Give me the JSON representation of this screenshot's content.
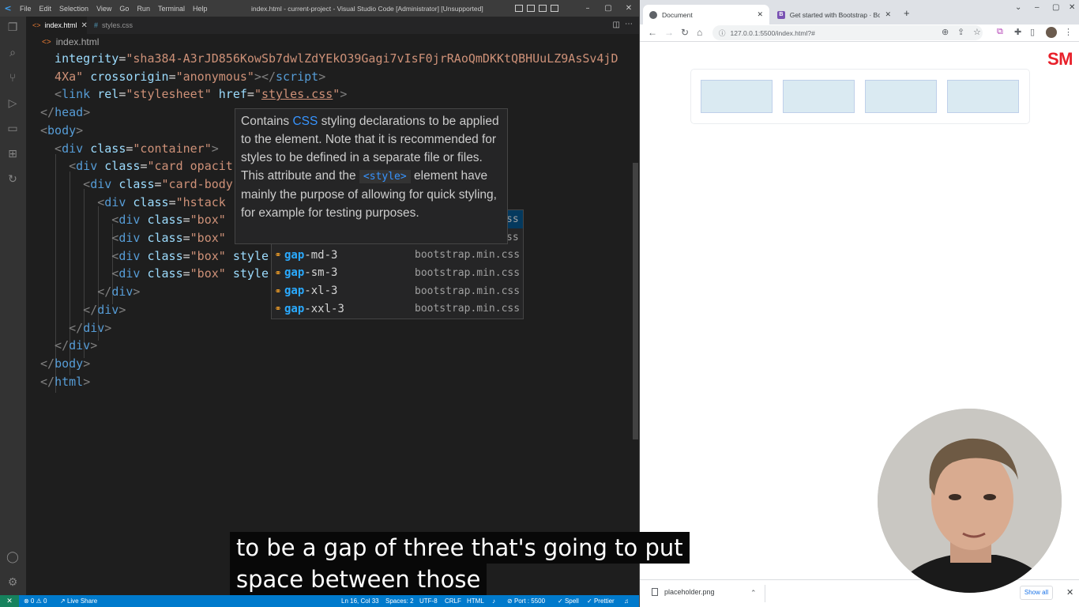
{
  "vscode": {
    "window_title": "index.html - current-project - Visual Studio Code [Administrator] [Unsupported]",
    "menu": [
      "File",
      "Edit",
      "Selection",
      "View",
      "Go",
      "Run",
      "Terminal",
      "Help"
    ],
    "tabs": [
      {
        "label": "index.html",
        "active": true,
        "icon": "html-file-icon"
      },
      {
        "label": "styles.css",
        "active": false,
        "icon": "css-file-icon"
      }
    ],
    "breadcrumb": "index.html",
    "code_lines": [
      [
        [
          "t-attr",
          "  integrity"
        ],
        [
          "t-txt",
          "="
        ],
        [
          "t-str",
          "\"sha384-A3rJD856KowSb7dwlZdYEkO39Gagi7vIsF0jrRAoQmDKKtQBHUuLZ9AsSv4jD"
        ]
      ],
      [
        [
          "t-str",
          "  4Xa\""
        ],
        [
          "t-txt",
          " "
        ],
        [
          "t-attr",
          "crossorigin"
        ],
        [
          "t-txt",
          "="
        ],
        [
          "t-str",
          "\"anonymous\""
        ],
        [
          "t-tag",
          "></"
        ],
        [
          "t-name",
          "script"
        ],
        [
          "t-tag",
          ">"
        ]
      ],
      [
        [
          "t-tag",
          "  <"
        ],
        [
          "t-name",
          "link"
        ],
        [
          "t-txt",
          " "
        ],
        [
          "t-attr",
          "rel"
        ],
        [
          "t-txt",
          "="
        ],
        [
          "t-str",
          "\"stylesheet\""
        ],
        [
          "t-txt",
          " "
        ],
        [
          "t-attr",
          "href"
        ],
        [
          "t-txt",
          "="
        ],
        [
          "t-str",
          "\""
        ],
        [
          "t-str t-link",
          "styles.css"
        ],
        [
          "t-str",
          "\""
        ],
        [
          "t-tag",
          ">"
        ]
      ],
      [
        [
          "t-tag",
          "</"
        ],
        [
          "t-name",
          "head"
        ],
        [
          "t-tag",
          ">"
        ]
      ],
      [
        [
          "t-tag",
          "<"
        ],
        [
          "t-name",
          "body"
        ],
        [
          "t-tag",
          ">"
        ]
      ],
      [
        [
          "t-tag",
          "  <"
        ],
        [
          "t-name",
          "div"
        ],
        [
          "t-txt",
          " "
        ],
        [
          "t-attr",
          "class"
        ],
        [
          "t-txt",
          "="
        ],
        [
          "t-str",
          "\"container\""
        ],
        [
          "t-tag",
          ">"
        ]
      ],
      [
        [
          "t-tag",
          "    <"
        ],
        [
          "t-name",
          "div"
        ],
        [
          "t-txt",
          " "
        ],
        [
          "t-attr",
          "class"
        ],
        [
          "t-txt",
          "="
        ],
        [
          "t-str",
          "\"card opacit"
        ]
      ],
      [
        [
          "t-tag",
          "      <"
        ],
        [
          "t-name",
          "div"
        ],
        [
          "t-txt",
          " "
        ],
        [
          "t-attr",
          "class"
        ],
        [
          "t-txt",
          "="
        ],
        [
          "t-str",
          "\"card-body"
        ]
      ],
      [
        [
          "t-tag",
          "        <"
        ],
        [
          "t-name",
          "div"
        ],
        [
          "t-txt",
          " "
        ],
        [
          "t-attr",
          "class"
        ],
        [
          "t-txt",
          "="
        ],
        [
          "t-str",
          "\"hstack"
        ]
      ],
      [
        [
          "t-tag",
          "          <"
        ],
        [
          "t-name",
          "div"
        ],
        [
          "t-txt",
          " "
        ],
        [
          "t-attr",
          "class"
        ],
        [
          "t-txt",
          "="
        ],
        [
          "t-str",
          "\"box\""
        ]
      ],
      [
        [
          "t-tag",
          "          <"
        ],
        [
          "t-name",
          "div"
        ],
        [
          "t-txt",
          " "
        ],
        [
          "t-attr",
          "class"
        ],
        [
          "t-txt",
          "="
        ],
        [
          "t-str",
          "\"box\""
        ]
      ],
      [
        [
          "t-tag",
          "          <"
        ],
        [
          "t-name",
          "div"
        ],
        [
          "t-txt",
          " "
        ],
        [
          "t-attr",
          "class"
        ],
        [
          "t-txt",
          "="
        ],
        [
          "t-str",
          "\"box\""
        ],
        [
          "t-txt",
          " "
        ],
        [
          "t-attr",
          "style"
        ]
      ],
      [
        [
          "t-tag",
          "          <"
        ],
        [
          "t-name",
          "div"
        ],
        [
          "t-txt",
          " "
        ],
        [
          "t-attr",
          "class"
        ],
        [
          "t-txt",
          "="
        ],
        [
          "t-str",
          "\"box\""
        ],
        [
          "t-txt",
          " "
        ],
        [
          "t-attr",
          "style"
        ]
      ],
      [
        [
          "t-tag",
          "        </"
        ],
        [
          "t-name",
          "div"
        ],
        [
          "t-tag",
          ">"
        ]
      ],
      [
        [
          "t-tag",
          "      </"
        ],
        [
          "t-name",
          "div"
        ],
        [
          "t-tag",
          ">"
        ]
      ],
      [
        [
          "t-tag",
          "    </"
        ],
        [
          "t-name",
          "div"
        ],
        [
          "t-tag",
          ">"
        ]
      ],
      [
        [
          "t-tag",
          "  </"
        ],
        [
          "t-name",
          "div"
        ],
        [
          "t-tag",
          ">"
        ]
      ],
      [
        [
          "t-tag",
          "</"
        ],
        [
          "t-name",
          "body"
        ],
        [
          "t-tag",
          ">"
        ]
      ],
      [
        [
          "t-tag",
          "</"
        ],
        [
          "t-name",
          "html"
        ],
        [
          "t-tag",
          ">"
        ]
      ]
    ],
    "hover": {
      "before": "Contains ",
      "highlight": "CSS",
      "middle": " styling declarations to be applied to the element. Note that it is recommended for styles to be defined in a separate file or files. This attribute and the ",
      "code": "<style>",
      "after": " element have mainly the purpose of allowing for quick styling, for example for testing purposes."
    },
    "suggestions": [
      {
        "match": "",
        "rest": "",
        "source": "ss",
        "selected": true
      },
      {
        "match": "",
        "rest": "",
        "source": "ss",
        "selected": false
      },
      {
        "match": "gap",
        "rest": "-md-3",
        "source": "bootstrap.min.css",
        "selected": false
      },
      {
        "match": "gap",
        "rest": "-sm-3",
        "source": "bootstrap.min.css",
        "selected": false
      },
      {
        "match": "gap",
        "rest": "-xl-3",
        "source": "bootstrap.min.css",
        "selected": false
      },
      {
        "match": "gap",
        "rest": "-xxl-3",
        "source": "bootstrap.min.css",
        "selected": false
      }
    ],
    "status": {
      "remote": "✕",
      "problems": "⊗ 0 ⚠ 0",
      "liveshare": "Live Share",
      "cursor": "Ln 16, Col 33",
      "spaces": "Spaces: 2",
      "encoding": "UTF-8",
      "eol": "CRLF",
      "language": "HTML",
      "port": "Port : 5500",
      "spell": "Spell",
      "prettier": "Prettier"
    }
  },
  "browser": {
    "tabs": [
      {
        "title": "Document",
        "active": true
      },
      {
        "title": "Get started with Bootstrap · Boo",
        "active": false
      }
    ],
    "url": "127.0.0.1:5500/index.html?#",
    "logo_text": "SM",
    "box_count": 4,
    "download": {
      "file": "placeholder.png",
      "show_all": "Show all"
    }
  },
  "captions": [
    "to be a gap of three that's going to put",
    "space between those"
  ],
  "colors": {
    "accent": "#007acc",
    "box_fill": "#d6e8f1",
    "logo": "#e8202a"
  }
}
